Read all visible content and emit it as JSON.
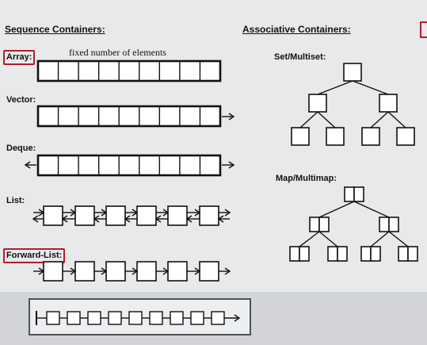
{
  "headings": {
    "sequence": "Sequence Containers:",
    "associative": "Associative Containers:"
  },
  "labels": {
    "array": "Array:",
    "vector": "Vector:",
    "deque": "Deque:",
    "list": "List:",
    "forward_list": "Forward-List:",
    "set_multiset": "Set/Multiset:",
    "map_multimap": "Map/Multimap:"
  },
  "notes": {
    "array_note": "fixed number of elements"
  },
  "colors": {
    "highlight_border": "#b31d2d",
    "slide_background": "#e8e9eb"
  },
  "icons": {
    "arrow": "right-arrow",
    "link": "double-arrow"
  }
}
